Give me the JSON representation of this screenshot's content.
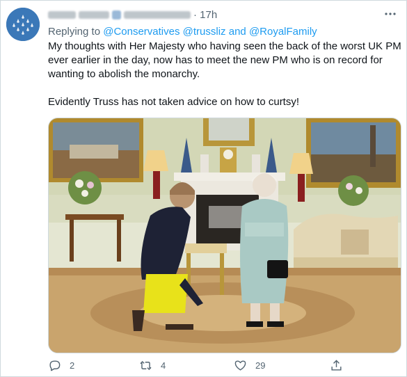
{
  "tweet": {
    "time": "17h",
    "replying_to_label": "Replying to",
    "replying_to_handles": "@Conservatives @trussliz",
    "replying_and": "and",
    "replying_to_last": "@RoyalFamily",
    "body_paragraph_1": "My thoughts with Her Majesty who having seen the back of the worst UK PM ever earlier in the day, now has to meet the new PM who is on record for wanting to abolish the monarchy.",
    "body_paragraph_2": "Evidently Truss has not taken advice on how to curtsy!"
  },
  "actions": {
    "reply_count": "2",
    "retweet_count": "4",
    "like_count": "29"
  },
  "colors": {
    "link": "#1d9bf0",
    "secondary_text": "#536471",
    "primary_text": "#0f1419",
    "border": "#cfd9de"
  }
}
